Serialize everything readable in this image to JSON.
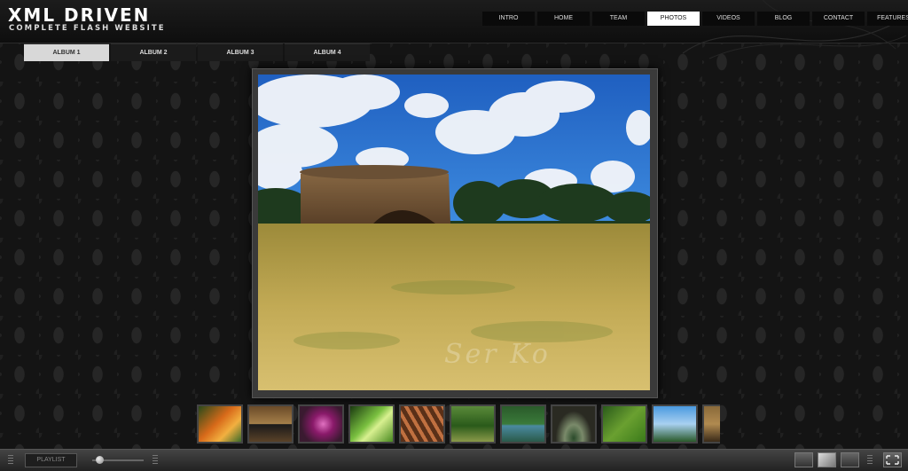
{
  "logo": {
    "title": "XML DRIVEN",
    "subtitle": "COMPLETE FLASH WEBSITE"
  },
  "nav": {
    "items": [
      "INTRO",
      "HOME",
      "TEAM",
      "PHOTOS",
      "VIDEOS",
      "BLOG",
      "CONTACT",
      "FEATURES"
    ],
    "active": "PHOTOS"
  },
  "albums": {
    "tabs": [
      "ALBUM 1",
      "ALBUM 2",
      "ALBUM 3",
      "ALBUM 4"
    ],
    "active": "ALBUM 1"
  },
  "photo": {
    "watermark": "Ser Ko"
  },
  "thumbnails": [
    {
      "name": "thumb-orange-flower"
    },
    {
      "name": "thumb-stone-arch"
    },
    {
      "name": "thumb-purple-flower"
    },
    {
      "name": "thumb-green-leaf"
    },
    {
      "name": "thumb-brown-bark"
    },
    {
      "name": "thumb-forest-path"
    },
    {
      "name": "thumb-pond"
    },
    {
      "name": "thumb-tree-arch"
    },
    {
      "name": "thumb-grass"
    },
    {
      "name": "thumb-blue-sky"
    },
    {
      "name": "thumb-stone-wall"
    }
  ],
  "controls": {
    "playlist_label": "PLAYLIST",
    "volume_level": 0.15
  },
  "colors": {
    "background": "#141414",
    "nav_active": "#ffffff",
    "album_active": "#d8d8d8"
  }
}
